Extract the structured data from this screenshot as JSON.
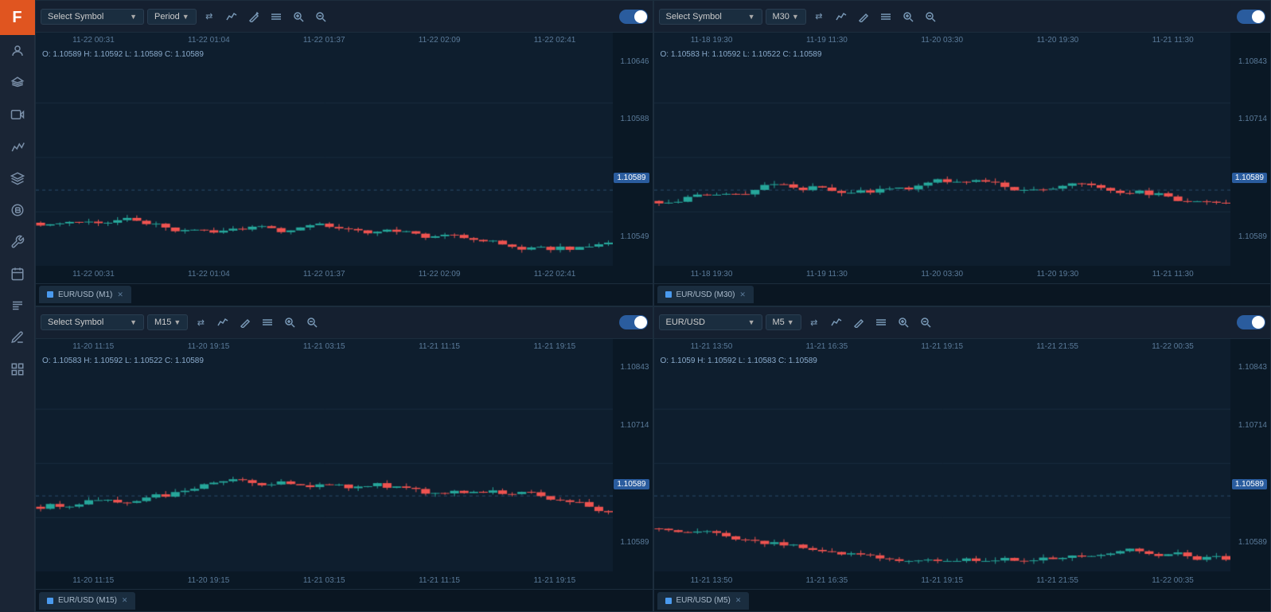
{
  "app": {
    "logo": "F",
    "logo_bg": "#e05520"
  },
  "sidebar": {
    "items": [
      {
        "id": "user",
        "icon": "user"
      },
      {
        "id": "balance",
        "icon": "balance"
      },
      {
        "id": "video",
        "icon": "video"
      },
      {
        "id": "chart-line",
        "icon": "chart-line"
      },
      {
        "id": "graduation",
        "icon": "graduation"
      },
      {
        "id": "crypto",
        "icon": "crypto"
      },
      {
        "id": "tools",
        "icon": "tools"
      },
      {
        "id": "calendar",
        "icon": "calendar"
      },
      {
        "id": "news",
        "icon": "news"
      },
      {
        "id": "pen",
        "icon": "pen"
      },
      {
        "id": "grid",
        "icon": "grid"
      }
    ]
  },
  "panels": [
    {
      "id": "top-left",
      "symbol": "Select Symbol",
      "period": "Period",
      "period_has_arrow": true,
      "ohlc": "O: 1.10589  H: 1.10592  L: 1.10589  C: 1.10589",
      "timestamps": [
        "11-22 00:31",
        "11-22 01:04",
        "11-22 01:37",
        "11-22 02:09",
        "11-22 02:41"
      ],
      "prices": [
        "1.10646",
        "1.10588",
        "1.10549"
      ],
      "current_price": "1.10589",
      "bottom_timestamps": [
        "11-22 00:31",
        "11-22 01:04",
        "11-22 01:37",
        "11-22 02:09",
        "11-22 02:41"
      ],
      "tab_label": "EUR/USD (M1)",
      "line_pct": 60,
      "candles": [
        {
          "x": 0,
          "o": 60,
          "h": 10,
          "l": 80,
          "c": 55,
          "bull": false
        },
        {
          "x": 1,
          "o": 55,
          "h": 5,
          "l": 75,
          "c": 62,
          "bull": true
        },
        {
          "x": 2,
          "o": 62,
          "h": 20,
          "l": 85,
          "c": 58,
          "bull": false
        },
        {
          "x": 3,
          "o": 58,
          "h": 30,
          "l": 90,
          "c": 65,
          "bull": true
        },
        {
          "x": 4,
          "o": 65,
          "h": 35,
          "l": 95,
          "c": 72,
          "bull": true
        },
        {
          "x": 5,
          "o": 72,
          "h": 40,
          "l": 100,
          "c": 68,
          "bull": false
        },
        {
          "x": 6,
          "o": 68,
          "h": 50,
          "l": 105,
          "c": 75,
          "bull": true
        },
        {
          "x": 7,
          "o": 75,
          "h": 60,
          "l": 115,
          "c": 80,
          "bull": true
        },
        {
          "x": 8,
          "o": 80,
          "h": 70,
          "l": 120,
          "c": 78,
          "bull": false
        },
        {
          "x": 9,
          "o": 78,
          "h": 75,
          "l": 125,
          "c": 85,
          "bull": true
        },
        {
          "x": 10,
          "o": 85,
          "h": 80,
          "l": 130,
          "c": 90,
          "bull": true
        },
        {
          "x": 11,
          "o": 90,
          "h": 88,
          "l": 135,
          "c": 88,
          "bull": false
        },
        {
          "x": 12,
          "o": 88,
          "h": 95,
          "l": 140,
          "c": 98,
          "bull": true
        },
        {
          "x": 13,
          "o": 98,
          "h": 100,
          "l": 145,
          "c": 102,
          "bull": true
        },
        {
          "x": 14,
          "o": 102,
          "h": 105,
          "l": 150,
          "c": 108,
          "bull": true
        },
        {
          "x": 15,
          "o": 108,
          "h": 112,
          "l": 155,
          "c": 115,
          "bull": true
        },
        {
          "x": 16,
          "o": 115,
          "h": 118,
          "l": 158,
          "c": 112,
          "bull": false
        },
        {
          "x": 17,
          "o": 112,
          "h": 120,
          "l": 160,
          "c": 118,
          "bull": true
        },
        {
          "x": 18,
          "o": 118,
          "h": 125,
          "l": 162,
          "c": 122,
          "bull": true
        },
        {
          "x": 19,
          "o": 122,
          "h": 128,
          "l": 165,
          "c": 130,
          "bull": true
        },
        {
          "x": 20,
          "o": 130,
          "h": 132,
          "l": 168,
          "c": 128,
          "bull": false
        },
        {
          "x": 21,
          "o": 128,
          "h": 135,
          "l": 170,
          "c": 135,
          "bull": true
        },
        {
          "x": 22,
          "o": 135,
          "h": 140,
          "l": 175,
          "c": 142,
          "bull": true
        },
        {
          "x": 23,
          "o": 142,
          "h": 148,
          "l": 182,
          "c": 148,
          "bull": true
        },
        {
          "x": 24,
          "o": 148,
          "h": 152,
          "l": 188,
          "c": 145,
          "bull": false
        },
        {
          "x": 25,
          "o": 145,
          "h": 155,
          "l": 192,
          "c": 155,
          "bull": true
        },
        {
          "x": 26,
          "o": 155,
          "h": 160,
          "l": 198,
          "c": 162,
          "bull": true
        },
        {
          "x": 27,
          "o": 162,
          "h": 168,
          "l": 205,
          "c": 170,
          "bull": true
        },
        {
          "x": 28,
          "o": 170,
          "h": 175,
          "l": 215,
          "c": 165,
          "bull": false
        },
        {
          "x": 29,
          "o": 165,
          "h": 172,
          "l": 218,
          "c": 172,
          "bull": true
        },
        {
          "x": 30,
          "o": 172,
          "h": 178,
          "l": 222,
          "c": 178,
          "bull": true
        }
      ]
    },
    {
      "id": "top-right",
      "symbol": "Select Symbol",
      "period": "M30",
      "period_has_arrow": true,
      "ohlc": "O: 1.10583  H: 1.10592  L: 1.10522  C: 1.10589",
      "timestamps": [
        "11-18 19:30",
        "11-19 11:30",
        "11-20 03:30",
        "11-20 19:30",
        "11-21 11:30"
      ],
      "prices": [
        "1.10843",
        "1.10714",
        "1.10589"
      ],
      "current_price": "1.10589",
      "bottom_timestamps": [
        "11-18 19:30",
        "11-19 11:30",
        "11-20 03:30",
        "11-20 19:30",
        "11-21 11:30"
      ],
      "tab_label": "EUR/USD (M30)",
      "line_pct": 78
    },
    {
      "id": "bottom-left",
      "symbol": "Select Symbol",
      "period": "M15",
      "period_has_arrow": true,
      "ohlc": "O: 1.10583  H: 1.10592  L: 1.10522  C: 1.10589",
      "timestamps": [
        "11-20 11:15",
        "11-20 19:15",
        "11-21 03:15",
        "11-21 11:15",
        "11-21 19:15"
      ],
      "prices": [
        "1.10843",
        "1.10714",
        "1.10589"
      ],
      "current_price": "1.10589",
      "bottom_timestamps": [
        "11-20 11:15",
        "11-20 19:15",
        "11-21 03:15",
        "11-21 11:15",
        "11-21 19:15"
      ],
      "tab_label": "EUR/USD (M15)",
      "line_pct": 72
    },
    {
      "id": "bottom-right",
      "symbol": "EUR/USD",
      "period": "M5",
      "period_has_arrow": true,
      "ohlc": "O: 1.1059  H: 1.10592  L: 1.10583  C: 1.10589",
      "timestamps": [
        "11-21 13:50",
        "11-21 16:35",
        "11-21 19:15",
        "11-21 21:55",
        "11-22 00:35"
      ],
      "prices": [
        "1.10843",
        "1.10714",
        "1.10589"
      ],
      "current_price": "1.10589",
      "bottom_timestamps": [
        "11-21 13:50",
        "11-21 16:35",
        "11-21 19:15",
        "11-21 21:55",
        "11-22 00:35"
      ],
      "tab_label": "EUR/USD (M5)",
      "line_pct": 72
    }
  ],
  "toolbar_icons": {
    "swap": "⇄",
    "chart_type": "📈",
    "draw": "✏",
    "indicators": "≡",
    "zoom_in": "🔍",
    "zoom_out": "🔎"
  }
}
